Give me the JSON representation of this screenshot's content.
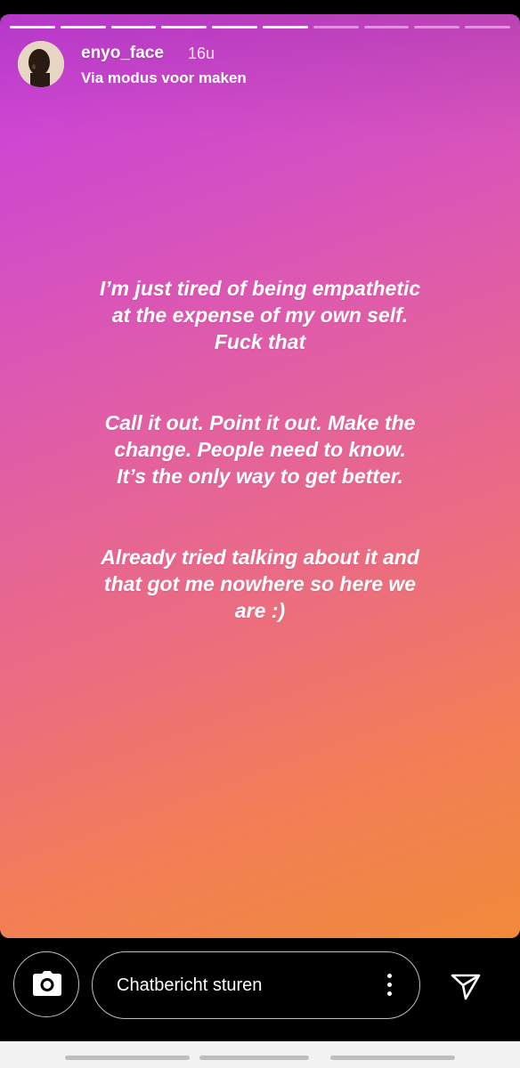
{
  "story": {
    "progress": {
      "total_segments": 10,
      "completed_segments": 6
    },
    "user": {
      "username": "enyo_face",
      "time_ago": "16u",
      "subtitle": "Via modus voor maken"
    },
    "text": {
      "paragraph1": "I’m just tired of being empathetic at the expense of my own self. Fuck that",
      "paragraph2": "Call it out. Point it out. Make the change. People need to know. It’s the only way to get better.",
      "paragraph3": "Already tried talking about it and that got me nowhere so here we are :)"
    },
    "background_colors": [
      "#c93ee0",
      "#e25fa3",
      "#f08a3a"
    ]
  },
  "reply_bar": {
    "camera_icon": "camera-icon",
    "message_placeholder": "Chatbericht sturen",
    "more_icon": "more-vertical-icon",
    "send_icon": "send-icon"
  },
  "system_nav": {
    "items": [
      "recent",
      "home",
      "back"
    ]
  }
}
